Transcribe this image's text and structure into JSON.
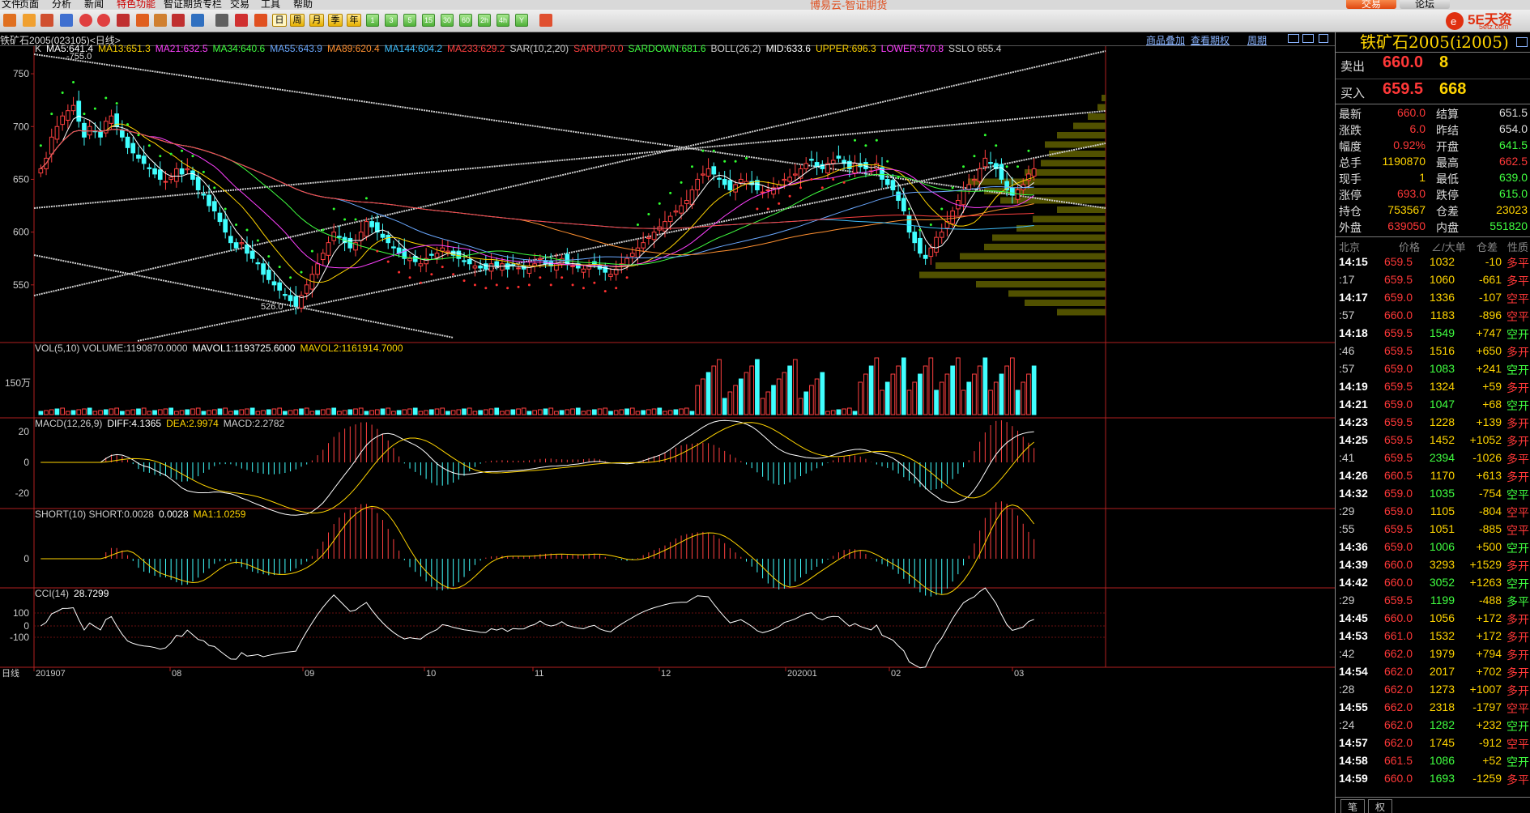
{
  "menu": {
    "items": [
      "文件",
      "页面",
      "分析",
      "新闻",
      "特色功能",
      "智证期货专栏",
      "交易",
      "工具",
      "帮助"
    ],
    "center_title": "博易云-智证期货",
    "trade_button": "交易",
    "forum_button": "论坛"
  },
  "logo": {
    "text": "5E天资",
    "site": "5etz.com"
  },
  "toolbar": {
    "groups": [
      "日",
      "周",
      "月",
      "季",
      "年"
    ],
    "periods": [
      "1",
      "3",
      "5",
      "15",
      "30",
      "60",
      "2h",
      "4h",
      "Y"
    ]
  },
  "infobar": {
    "instrument": "铁矿石2005(023105)<日线>",
    "links": [
      "商品叠加",
      "查看期权",
      "周期"
    ]
  },
  "main_panel": {
    "label": "K",
    "indicators": [
      {
        "text": "MA5:641.4",
        "color": "#ffffff"
      },
      {
        "text": "MA13:651.3",
        "color": "#ffd400"
      },
      {
        "text": "MA21:632.5",
        "color": "#ff40ff"
      },
      {
        "text": "MA34:640.6",
        "color": "#40ff40"
      },
      {
        "text": "MA55:643.9",
        "color": "#6aa8ff"
      },
      {
        "text": "MA89:620.4",
        "color": "#ff9030"
      },
      {
        "text": "MA144:604.2",
        "color": "#40c0ff"
      },
      {
        "text": "MA233:629.2",
        "color": "#ff4040"
      },
      {
        "text": "SAR(10,2,20)",
        "color": "#d0d0d0"
      },
      {
        "text": "SARUP:0.0",
        "color": "#ff4040"
      },
      {
        "text": "SARDOWN:681.6",
        "color": "#40ff40"
      },
      {
        "text": "BOLL(26,2)",
        "color": "#d0d0d0"
      },
      {
        "text": "MID:633.6",
        "color": "#ffffff"
      },
      {
        "text": "UPPER:696.3",
        "color": "#ffd400"
      },
      {
        "text": "LOWER:570.8",
        "color": "#ff40ff"
      },
      {
        "text": "SSLO 655.4",
        "color": "#d0d0d0"
      }
    ],
    "y_ticks": [
      "750",
      "700",
      "650",
      "600",
      "550"
    ],
    "high_label": "-755.0",
    "low_label": "526.0"
  },
  "vol_panel": {
    "indicators": [
      {
        "text": "VOL(5,10) VOLUME:1190870.0000",
        "color": "#d0d0d0"
      },
      {
        "text": "MAVOL1:1193725.6000",
        "color": "#ffffff"
      },
      {
        "text": "MAVOL2:1161914.7000",
        "color": "#ffd400"
      }
    ],
    "y_ticks": [
      "150万"
    ]
  },
  "macd_panel": {
    "indicators": [
      {
        "text": "MACD(12,26,9)",
        "color": "#d0d0d0"
      },
      {
        "text": "DIFF:4.1365",
        "color": "#ffffff"
      },
      {
        "text": "DEA:2.9974",
        "color": "#ffd400"
      },
      {
        "text": "MACD:2.2782",
        "color": "#d0d0d0"
      }
    ],
    "y_ticks": [
      "20",
      "0",
      "-20"
    ]
  },
  "short_panel": {
    "indicators": [
      {
        "text": "SHORT(10) SHORT:0.0028",
        "color": "#d0d0d0"
      },
      {
        "text": "0.0028",
        "color": "#ffffff"
      },
      {
        "text": "MA1:1.0259",
        "color": "#ffd400"
      }
    ],
    "y_ticks": [
      "0"
    ]
  },
  "cci_panel": {
    "indicators": [
      {
        "text": "CCI(14)",
        "color": "#d0d0d0"
      },
      {
        "text": "28.7299",
        "color": "#ffffff"
      }
    ],
    "y_ticks": [
      "100",
      "0",
      "-100"
    ]
  },
  "x_axis": {
    "period_label": "日线",
    "labels": [
      "201907",
      "08",
      "09",
      "10",
      "11",
      "12",
      "202001",
      "02",
      "03"
    ]
  },
  "quote": {
    "title": "铁矿石2005(i2005)",
    "sell": {
      "label": "卖出",
      "price": "660.0",
      "vol": "8"
    },
    "buy": {
      "label": "买入",
      "price": "659.5",
      "vol": "668"
    },
    "stats": [
      {
        "l1": "最新",
        "v1": "660.0",
        "c1": "#ff3838",
        "l2": "结算",
        "v2": "651.5",
        "c2": "#ddd"
      },
      {
        "l1": "涨跌",
        "v1": "6.0",
        "c1": "#ff3838",
        "l2": "昨结",
        "v2": "654.0",
        "c2": "#ddd"
      },
      {
        "l1": "幅度",
        "v1": "0.92%",
        "c1": "#ff3838",
        "l2": "开盘",
        "v2": "641.5",
        "c2": "#40ff40"
      },
      {
        "l1": "总手",
        "v1": "1190870",
        "c1": "#ffd400",
        "l2": "最高",
        "v2": "662.5",
        "c2": "#ff3838"
      },
      {
        "l1": "现手",
        "v1": "1",
        "c1": "#ffd400",
        "l2": "最低",
        "v2": "639.0",
        "c2": "#40ff40"
      },
      {
        "l1": "涨停",
        "v1": "693.0",
        "c1": "#ff3838",
        "l2": "跌停",
        "v2": "615.0",
        "c2": "#40ff40"
      },
      {
        "l1": "持仓",
        "v1": "753567",
        "c1": "#ffd400",
        "l2": "仓差",
        "v2": "23023",
        "c2": "#ffd400"
      },
      {
        "l1": "外盘",
        "v1": "639050",
        "c1": "#ff3838",
        "l2": "内盘",
        "v2": "551820",
        "c2": "#40ff40"
      }
    ],
    "tick_header": {
      "loc": "北京",
      "price": "价格",
      "vol": "∠/大单",
      "oi": "仓差",
      "nature": "性质"
    },
    "ticks": [
      {
        "t": "14:15",
        "p": "659.5",
        "v": "1032",
        "o": "-10",
        "n": "多平",
        "pc": "#ff3838",
        "vc": "#ffd400",
        "oc": "#ffd400",
        "nc": "#ff3838"
      },
      {
        "t": ":17",
        "p": "659.5",
        "v": "1060",
        "o": "-661",
        "n": "多平",
        "pc": "#ff3838",
        "vc": "#ffd400",
        "oc": "#ffd400",
        "nc": "#ff3838"
      },
      {
        "t": "14:17",
        "p": "659.0",
        "v": "1336",
        "o": "-107",
        "n": "空平",
        "pc": "#ff3838",
        "vc": "#ffd400",
        "oc": "#ffd400",
        "nc": "#ff3838"
      },
      {
        "t": ":57",
        "p": "660.0",
        "v": "1183",
        "o": "-896",
        "n": "空平",
        "pc": "#ff3838",
        "vc": "#ffd400",
        "oc": "#ffd400",
        "nc": "#ff3838"
      },
      {
        "t": "14:18",
        "p": "659.5",
        "v": "1549",
        "o": "+747",
        "n": "空开",
        "pc": "#ff3838",
        "vc": "#40ff40",
        "oc": "#ffd400",
        "nc": "#40ff40"
      },
      {
        "t": ":46",
        "p": "659.5",
        "v": "1516",
        "o": "+650",
        "n": "多开",
        "pc": "#ff3838",
        "vc": "#ffd400",
        "oc": "#ffd400",
        "nc": "#ff3838"
      },
      {
        "t": ":57",
        "p": "659.0",
        "v": "1083",
        "o": "+241",
        "n": "空开",
        "pc": "#ff3838",
        "vc": "#40ff40",
        "oc": "#ffd400",
        "nc": "#40ff40"
      },
      {
        "t": "14:19",
        "p": "659.5",
        "v": "1324",
        "o": "+59",
        "n": "多开",
        "pc": "#ff3838",
        "vc": "#ffd400",
        "oc": "#ffd400",
        "nc": "#ff3838"
      },
      {
        "t": "14:21",
        "p": "659.0",
        "v": "1047",
        "o": "+68",
        "n": "空开",
        "pc": "#ff3838",
        "vc": "#40ff40",
        "oc": "#ffd400",
        "nc": "#40ff40"
      },
      {
        "t": "14:23",
        "p": "659.5",
        "v": "1228",
        "o": "+139",
        "n": "多开",
        "pc": "#ff3838",
        "vc": "#ffd400",
        "oc": "#ffd400",
        "nc": "#ff3838"
      },
      {
        "t": "14:25",
        "p": "659.5",
        "v": "1452",
        "o": "+1052",
        "n": "多开",
        "pc": "#ff3838",
        "vc": "#ffd400",
        "oc": "#ffd400",
        "nc": "#ff3838"
      },
      {
        "t": ":41",
        "p": "659.5",
        "v": "2394",
        "o": "-1026",
        "n": "多平",
        "pc": "#ff3838",
        "vc": "#40ff40",
        "oc": "#ffd400",
        "nc": "#ff3838"
      },
      {
        "t": "14:26",
        "p": "660.5",
        "v": "1170",
        "o": "+613",
        "n": "多开",
        "pc": "#ff3838",
        "vc": "#ffd400",
        "oc": "#ffd400",
        "nc": "#ff3838"
      },
      {
        "t": "14:32",
        "p": "659.0",
        "v": "1035",
        "o": "-754",
        "n": "空平",
        "pc": "#ff3838",
        "vc": "#40ff40",
        "oc": "#ffd400",
        "nc": "#40ff40"
      },
      {
        "t": ":29",
        "p": "659.0",
        "v": "1105",
        "o": "-804",
        "n": "空平",
        "pc": "#ff3838",
        "vc": "#ffd400",
        "oc": "#ffd400",
        "nc": "#ff3838"
      },
      {
        "t": ":55",
        "p": "659.5",
        "v": "1051",
        "o": "-885",
        "n": "空平",
        "pc": "#ff3838",
        "vc": "#ffd400",
        "oc": "#ffd400",
        "nc": "#ff3838"
      },
      {
        "t": "14:36",
        "p": "659.0",
        "v": "1006",
        "o": "+500",
        "n": "空开",
        "pc": "#ff3838",
        "vc": "#40ff40",
        "oc": "#ffd400",
        "nc": "#40ff40"
      },
      {
        "t": "14:39",
        "p": "660.0",
        "v": "3293",
        "o": "+1529",
        "n": "多开",
        "pc": "#ff3838",
        "vc": "#ffd400",
        "oc": "#ffd400",
        "nc": "#ff3838"
      },
      {
        "t": "14:42",
        "p": "660.0",
        "v": "3052",
        "o": "+1263",
        "n": "空开",
        "pc": "#ff3838",
        "vc": "#40ff40",
        "oc": "#ffd400",
        "nc": "#40ff40"
      },
      {
        "t": ":29",
        "p": "659.5",
        "v": "1199",
        "o": "-488",
        "n": "多平",
        "pc": "#ff3838",
        "vc": "#40ff40",
        "oc": "#ffd400",
        "nc": "#40ff40"
      },
      {
        "t": "14:45",
        "p": "660.0",
        "v": "1056",
        "o": "+172",
        "n": "多开",
        "pc": "#ff3838",
        "vc": "#ffd400",
        "oc": "#ffd400",
        "nc": "#ff3838"
      },
      {
        "t": "14:53",
        "p": "661.0",
        "v": "1532",
        "o": "+172",
        "n": "多开",
        "pc": "#ff3838",
        "vc": "#ffd400",
        "oc": "#ffd400",
        "nc": "#ff3838"
      },
      {
        "t": ":42",
        "p": "662.0",
        "v": "1979",
        "o": "+794",
        "n": "多开",
        "pc": "#ff3838",
        "vc": "#ffd400",
        "oc": "#ffd400",
        "nc": "#ff3838"
      },
      {
        "t": "14:54",
        "p": "662.0",
        "v": "2017",
        "o": "+702",
        "n": "多开",
        "pc": "#ff3838",
        "vc": "#ffd400",
        "oc": "#ffd400",
        "nc": "#ff3838"
      },
      {
        "t": ":28",
        "p": "662.0",
        "v": "1273",
        "o": "+1007",
        "n": "多开",
        "pc": "#ff3838",
        "vc": "#ffd400",
        "oc": "#ffd400",
        "nc": "#ff3838"
      },
      {
        "t": "14:55",
        "p": "662.0",
        "v": "2318",
        "o": "-1797",
        "n": "空平",
        "pc": "#ff3838",
        "vc": "#ffd400",
        "oc": "#ffd400",
        "nc": "#ff3838"
      },
      {
        "t": ":24",
        "p": "662.0",
        "v": "1282",
        "o": "+232",
        "n": "空开",
        "pc": "#ff3838",
        "vc": "#40ff40",
        "oc": "#ffd400",
        "nc": "#40ff40"
      },
      {
        "t": "14:57",
        "p": "662.0",
        "v": "1745",
        "o": "-912",
        "n": "空平",
        "pc": "#ff3838",
        "vc": "#ffd400",
        "oc": "#ffd400",
        "nc": "#ff3838"
      },
      {
        "t": "14:58",
        "p": "661.5",
        "v": "1086",
        "o": "+52",
        "n": "空开",
        "pc": "#ff3838",
        "vc": "#40ff40",
        "oc": "#ffd400",
        "nc": "#40ff40"
      },
      {
        "t": "14:59",
        "p": "660.0",
        "v": "1693",
        "o": "-1259",
        "n": "多平",
        "pc": "#ff3838",
        "vc": "#40ff40",
        "oc": "#ffd400",
        "nc": "#ff3838"
      }
    ],
    "footer_tabs": [
      "笔",
      "权"
    ]
  },
  "chart_data": {
    "type": "candlestick",
    "title": "铁矿石2005(023105)<日线>",
    "x_labels": [
      "201907",
      "08",
      "09",
      "10",
      "11",
      "12",
      "202001",
      "02",
      "03"
    ],
    "y_ticks": [
      750,
      700,
      650,
      600,
      550
    ],
    "ylim": [
      500,
      770
    ],
    "high": 755.0,
    "low": 526.0,
    "last": {
      "open": 641.5,
      "high": 662.5,
      "low": 639.0,
      "close": 660.0,
      "volume": 1190870
    },
    "ma": {
      "MA5": 641.4,
      "MA13": 651.3,
      "MA21": 632.5,
      "MA34": 640.6,
      "MA55": 643.9,
      "MA89": 620.4,
      "MA144": 604.2,
      "MA233": 629.2
    },
    "boll": {
      "mid": 633.6,
      "upper": 696.3,
      "lower": 570.8
    },
    "macd": {
      "diff": 4.1365,
      "dea": 2.9974,
      "macd": 2.2782
    },
    "cci": 28.7299,
    "close_series": [
      660,
      670,
      690,
      700,
      710,
      715,
      720,
      705,
      690,
      700,
      695,
      690,
      705,
      710,
      700,
      690,
      680,
      675,
      670,
      665,
      660,
      655,
      650,
      648,
      652,
      660,
      655,
      660,
      650,
      640,
      635,
      625,
      620,
      610,
      600,
      590,
      585,
      590,
      580,
      575,
      570,
      560,
      555,
      550,
      545,
      540,
      535,
      530,
      540,
      550,
      560,
      570,
      580,
      590,
      600,
      595,
      590,
      585,
      590,
      600,
      610,
      605,
      600,
      595,
      590,
      585,
      580,
      575,
      575,
      572,
      570,
      575,
      578,
      580,
      585,
      582,
      578,
      575,
      572,
      570,
      568,
      566,
      565,
      570,
      568,
      570,
      565,
      568,
      566,
      565,
      568,
      570,
      575,
      570,
      568,
      570,
      575,
      570,
      568,
      566,
      565,
      568,
      570,
      565,
      562,
      560,
      565,
      570,
      575,
      580,
      585,
      590,
      595,
      600,
      605,
      610,
      615,
      620,
      625,
      630,
      640,
      650,
      655,
      660,
      655,
      650,
      645,
      640,
      645,
      650,
      648,
      645,
      640,
      638,
      640,
      642,
      645,
      650,
      652,
      655,
      660,
      665,
      668,
      662,
      660,
      665,
      668,
      670,
      665,
      660,
      665,
      662,
      660,
      658,
      665,
      650,
      645,
      640,
      630,
      620,
      600,
      590,
      580,
      575,
      585,
      595,
      600,
      610,
      620,
      630,
      640,
      645,
      650,
      660,
      670,
      665,
      660,
      650,
      640,
      635,
      640,
      645,
      655,
      660
    ]
  }
}
